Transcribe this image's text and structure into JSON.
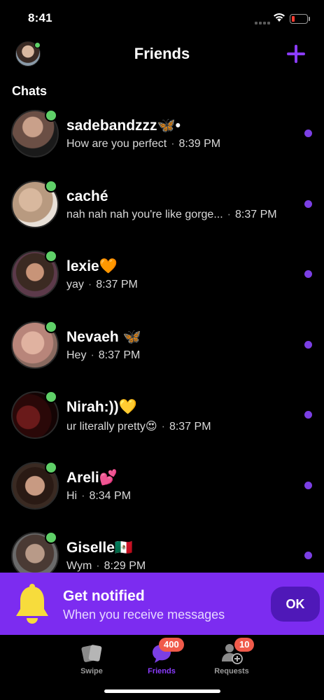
{
  "status_bar": {
    "time": "8:41",
    "battery_level": 0.18,
    "battery_color": "#ff3b30"
  },
  "header": {
    "title": "Friends",
    "add_icon": "plus-icon",
    "accent": "#8b3cff"
  },
  "section": {
    "label": "Chats"
  },
  "chats": [
    {
      "name": "sadebandzzz🦋•",
      "message": "How are you perfect",
      "time": "8:39 PM",
      "online": true,
      "unread": true
    },
    {
      "name": "caché",
      "message": "nah nah nah you're like gorge...",
      "time": "8:37 PM",
      "online": true,
      "unread": true
    },
    {
      "name": "lexie🧡",
      "message": "yay",
      "time": "8:37 PM",
      "online": true,
      "unread": true
    },
    {
      "name": "Nevaeh 🦋",
      "message": "Hey",
      "time": "8:37 PM",
      "online": true,
      "unread": true
    },
    {
      "name": "Nirah:))💛",
      "message": "ur literally pretty😍",
      "time": "8:37 PM",
      "online": true,
      "unread": true
    },
    {
      "name": "Areli💕",
      "message": "Hi",
      "time": "8:34 PM",
      "online": true,
      "unread": true
    },
    {
      "name": "Giselle🇲🇽",
      "message": "Wym",
      "time": "8:29 PM",
      "online": true,
      "unread": true
    }
  ],
  "notify": {
    "title": "Get notified",
    "subtitle": "When you receive messages",
    "ok_label": "OK",
    "icon": "bell-icon",
    "background": "#7c2cf0"
  },
  "tabs": [
    {
      "label": "Swipe",
      "icon": "cards-icon",
      "badge": ""
    },
    {
      "label": "Friends",
      "icon": "chat-bubble-icon",
      "badge": "400"
    },
    {
      "label": "Requests",
      "icon": "add-person-icon",
      "badge": "10"
    }
  ]
}
